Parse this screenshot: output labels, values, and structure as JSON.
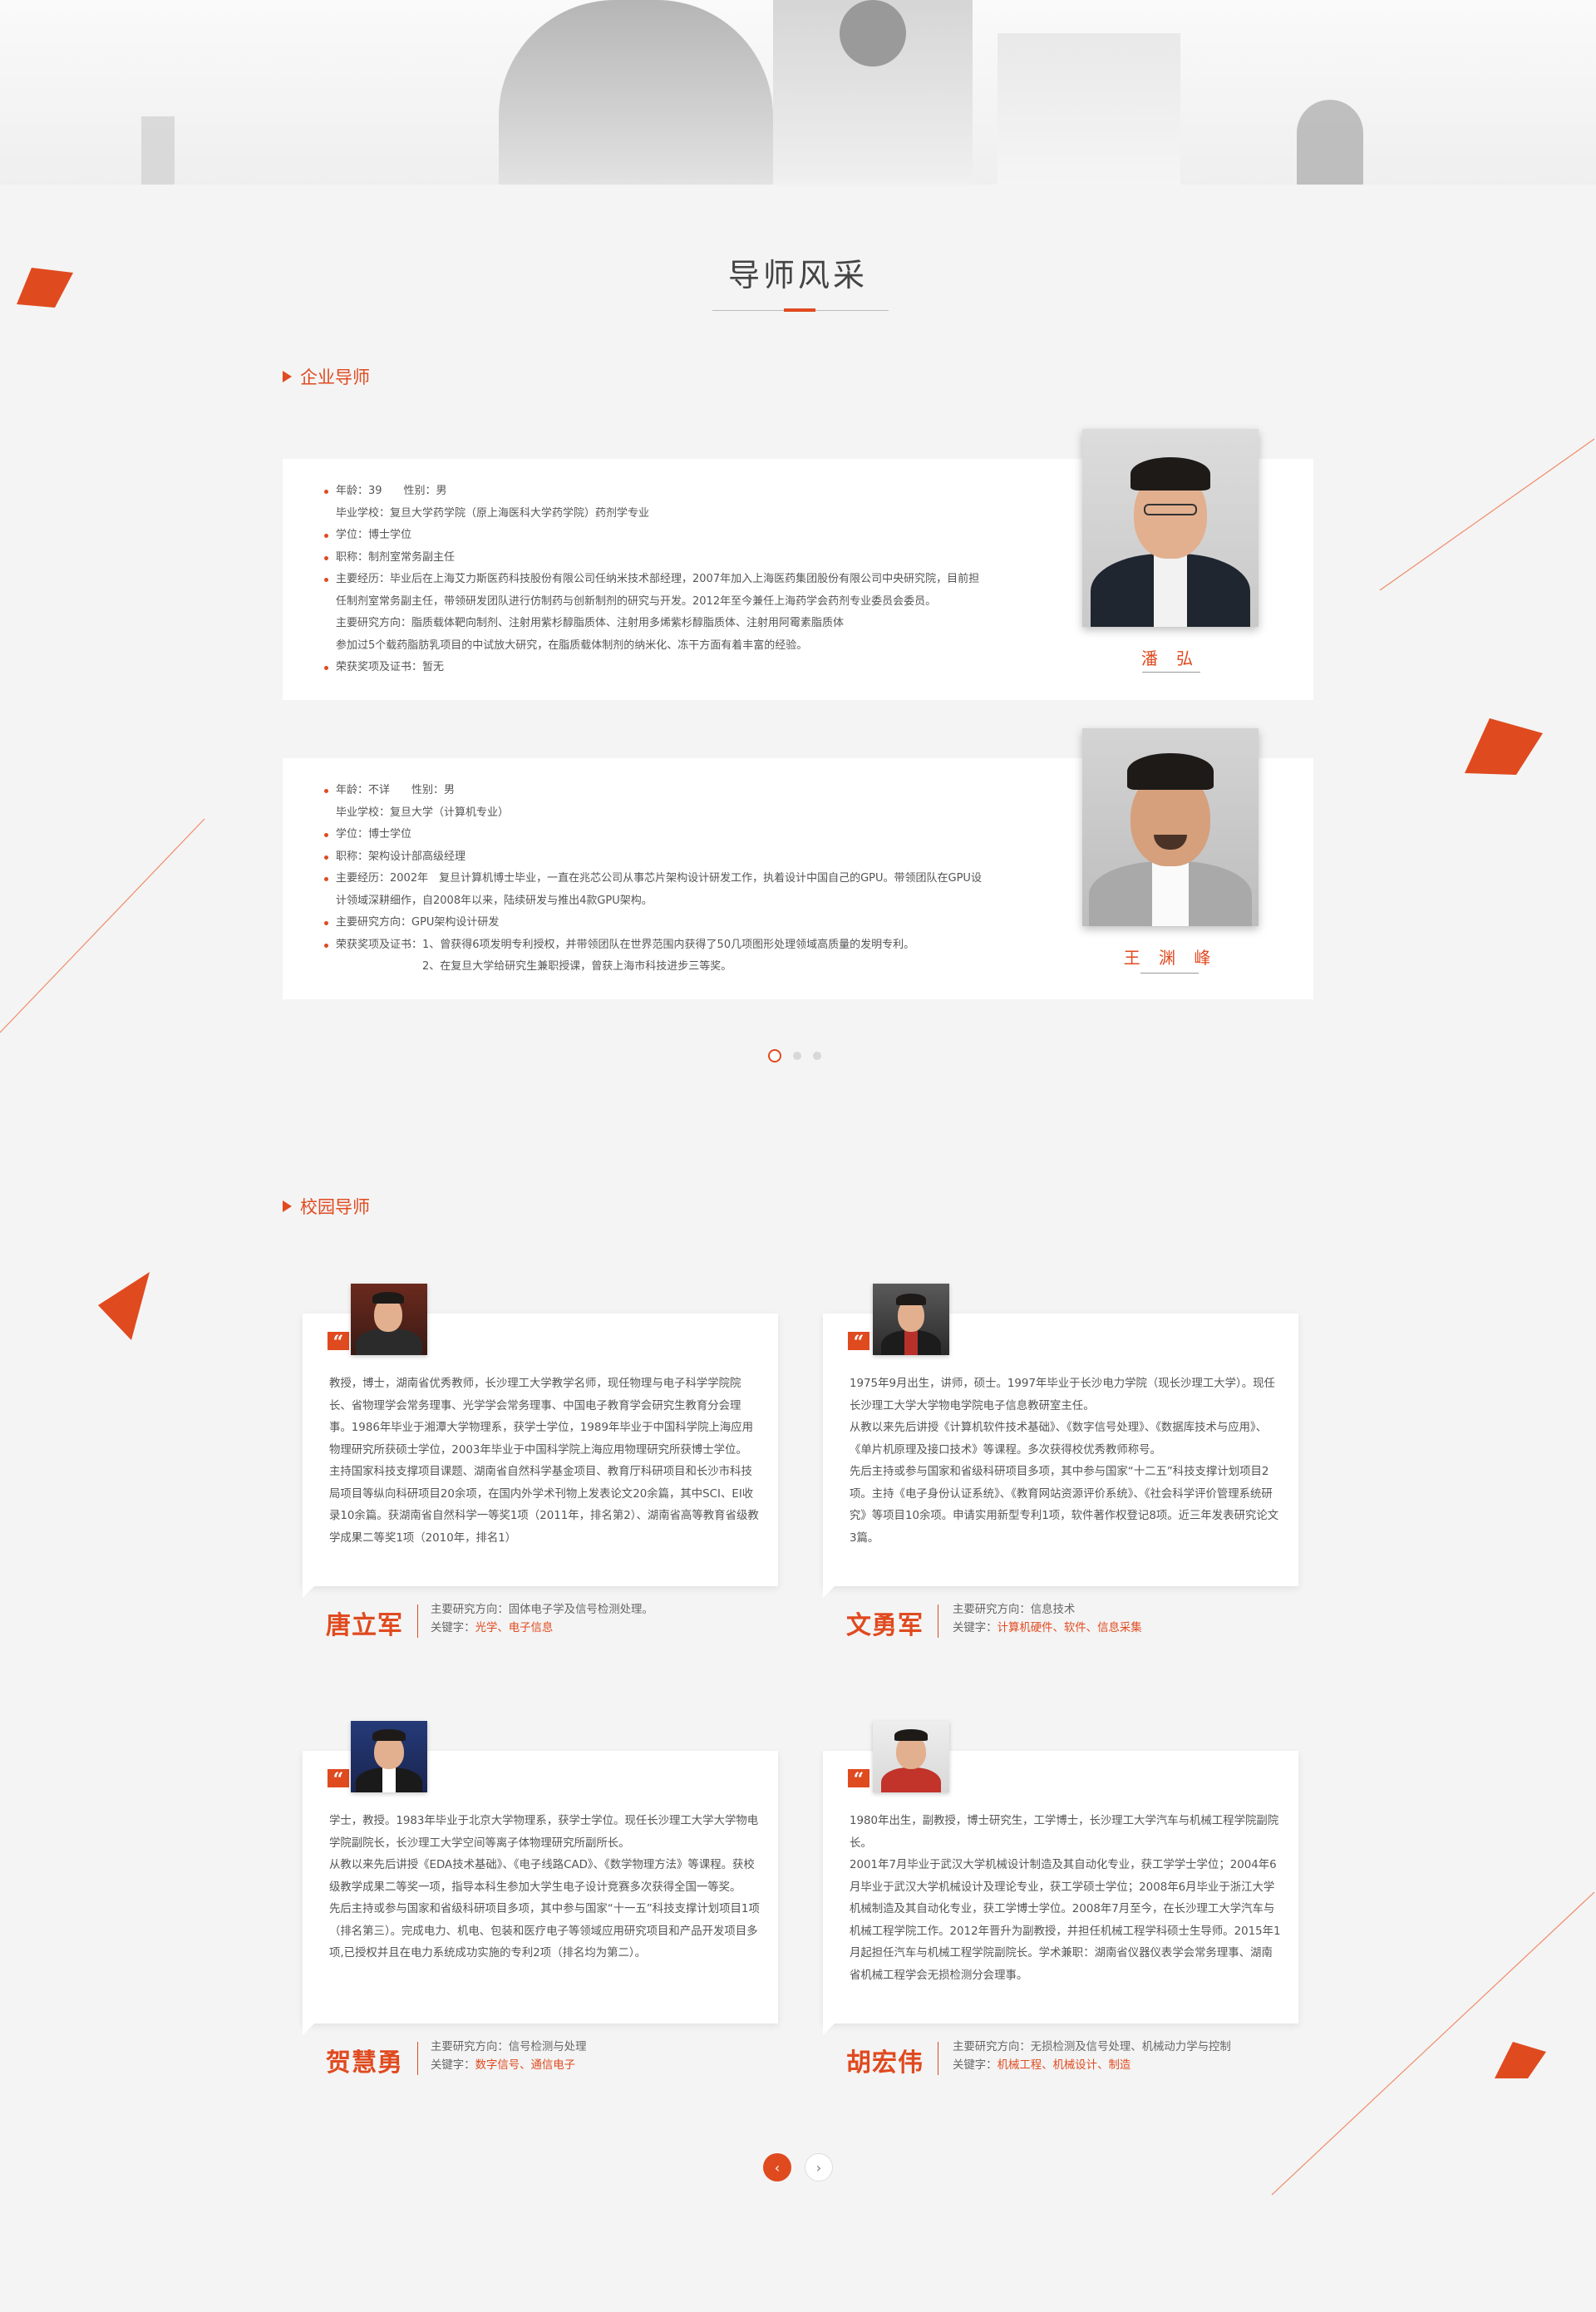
{
  "section_title": "导师风采",
  "enterprise": {
    "heading": "企业导师",
    "mentors": [
      {
        "name": "潘 弘",
        "lines": [
          {
            "text": "年龄：39　　性别：男",
            "bullet": true
          },
          {
            "text": "毕业学校：复旦大学药学院（原上海医科大学药学院）药剂学专业",
            "bullet": false
          },
          {
            "text": "学位：博士学位",
            "bullet": true
          },
          {
            "text": "职称：制剂室常务副主任",
            "bullet": true
          },
          {
            "text": "主要经历：毕业后在上海艾力斯医药科技股份有限公司任纳米技术部经理，2007年加入上海医药集团股份有限公司中央研究院，目前担",
            "bullet": true
          },
          {
            "text": "任制剂室常务副主任，带领研发团队进行仿制药与创新制剂的研究与开发。2012年至今兼任上海药学会药剂专业委员会委员。",
            "bullet": false
          },
          {
            "text": "主要研究方向：脂质载体靶向制剂、注射用紫杉醇脂质体、注射用多烯紫杉醇脂质体、注射用阿霉素脂质体",
            "bullet": false
          },
          {
            "text": "参加过5个载药脂肪乳项目的中试放大研究，在脂质载体制剂的纳米化、冻干方面有着丰富的经验。",
            "bullet": false
          },
          {
            "text": "荣获奖项及证书：暂无",
            "bullet": true
          }
        ]
      },
      {
        "name": "王 渊 峰",
        "lines": [
          {
            "text": "年龄：不详　　性别：男",
            "bullet": true
          },
          {
            "text": "毕业学校：复旦大学（计算机专业）",
            "bullet": false
          },
          {
            "text": "学位：博士学位",
            "bullet": true
          },
          {
            "text": "职称：架构设计部高级经理",
            "bullet": true
          },
          {
            "text": "主要经历：2002年　复旦计算机博士毕业，一直在兆芯公司从事芯片架构设计研发工作，执着设计中国自己的GPU。带领团队在GPU设",
            "bullet": true
          },
          {
            "text": "计领域深耕细作，自2008年以来，陆续研发与推出4款GPU架构。",
            "bullet": false
          },
          {
            "text": "主要研究方向：GPU架构设计研发",
            "bullet": true
          },
          {
            "text": "荣获奖项及证书：1、曾获得6项发明专利授权，并带领团队在世界范围内获得了50几项图形处理领域高质量的发明专利。",
            "bullet": true
          },
          {
            "text": "　　　　　　　　2、在复旦大学给研究生兼职授课，曾获上海市科技进步三等奖。",
            "bullet": false
          }
        ]
      }
    ]
  },
  "campus": {
    "heading": "校园导师",
    "mentors": [
      {
        "name": "唐立军",
        "bio": "教授，博士，湖南省优秀教师，长沙理工大学教学名师，现任物理与电子科学学院院长、省物理学会常务理事、光学学会常务理事、中国电子教育学会研究生教育分会理事。1986年毕业于湘潭大学物理系，获学士学位，1989年毕业于中国科学院上海应用物理研究所获硕士学位，2003年毕业于中国科学院上海应用物理研究所获博士学位。\n主持国家科技支撑项目课题、湖南省自然科学基金项目、教育厅科研项目和长沙市科技局项目等纵向科研项目20余项，在国内外学术刊物上发表论文20余篇，其中SCI、EI收录10余篇。获湖南省自然科学一等奖1项（2011年，排名第2）、湖南省高等教育省级教学成果二等奖1项（2010年，排名1）",
        "research_label": "主要研究方向：",
        "research": "固体电子学及信号检测处理。",
        "keyword_label": "关键字：",
        "keywords": "光学、电子信息"
      },
      {
        "name": "文勇军",
        "bio": "1975年9月出生，讲师，硕士。1997年毕业于长沙电力学院（现长沙理工大学）。现任长沙理工大学大学物电学院电子信息教研室主任。\n从教以来先后讲授《计算机软件技术基础》、《数字信号处理》、《数据库技术与应用》、《单片机原理及接口技术》等课程。多次获得校优秀教师称号。\n先后主持或参与国家和省级科研项目多项，其中参与国家“十二五”科技支撑计划项目2项。主持《电子身份认证系统》、《教育网站资源评价系统》、《社会科学评价管理系统研究》等项目10余项。申请实用新型专利1项，软件著作权登记8项。近三年发表研究论文3篇。",
        "research_label": "主要研究方向：",
        "research": "信息技术",
        "keyword_label": "关键字：",
        "keywords": "计算机硬件、软件、信息采集"
      },
      {
        "name": "贺慧勇",
        "bio": "学士，教授。1983年毕业于北京大学物理系，获学士学位。现任长沙理工大学大学物电学院副院长，长沙理工大学空间等离子体物理研究所副所长。\n从教以来先后讲授《EDA技术基础》、《电子线路CAD》、《数学物理方法》等课程。获校级教学成果二等奖一项，指导本科生参加大学生电子设计竞赛多次获得全国一等奖。\n先后主持或参与国家和省级科研项目多项，其中参与国家“十一五”科技支撑计划项目1项（排名第三）。完成电力、机电、包装和医疗电子等领域应用研究项目和产品开发项目多项,已授权并且在电力系统成功实施的专利2项（排名均为第二）。",
        "research_label": "主要研究方向：",
        "research": "信号检测与处理",
        "keyword_label": "关键字：",
        "keywords": "数字信号、通信电子"
      },
      {
        "name": "胡宏伟",
        "bio": "1980年出生，副教授，博士研究生，工学博士，长沙理工大学汽车与机械工程学院副院长。\n2001年7月毕业于武汉大学机械设计制造及其自动化专业，获工学学士学位；2004年6月毕业于武汉大学机械设计及理论专业，获工学硕士学位；2008年6月毕业于浙江大学机械制造及其自动化专业，获工学博士学位。2008年7月至今，在长沙理工大学汽车与机械工程学院工作。2012年晋升为副教授，并担任机械工程学科硕士生导师。2015年1月起担任汽车与机械工程学院副院长。学术兼职：湖南省仪器仪表学会常务理事、湖南省机械工程学会无损检测分会理事。",
        "research_label": "主要研究方向：",
        "research": "无损检测及信号处理、机械动力学与控制",
        "keyword_label": "关键字：",
        "keywords": "机械工程、机械设计、制造"
      }
    ]
  },
  "pager": {
    "prev_label": "‹",
    "next_label": "›"
  },
  "colors": {
    "accent": "#e04a1f",
    "background": "#f4f4f4"
  },
  "icons": {
    "section_marker": "triangle-right-icon",
    "quote": "quote-icon"
  }
}
